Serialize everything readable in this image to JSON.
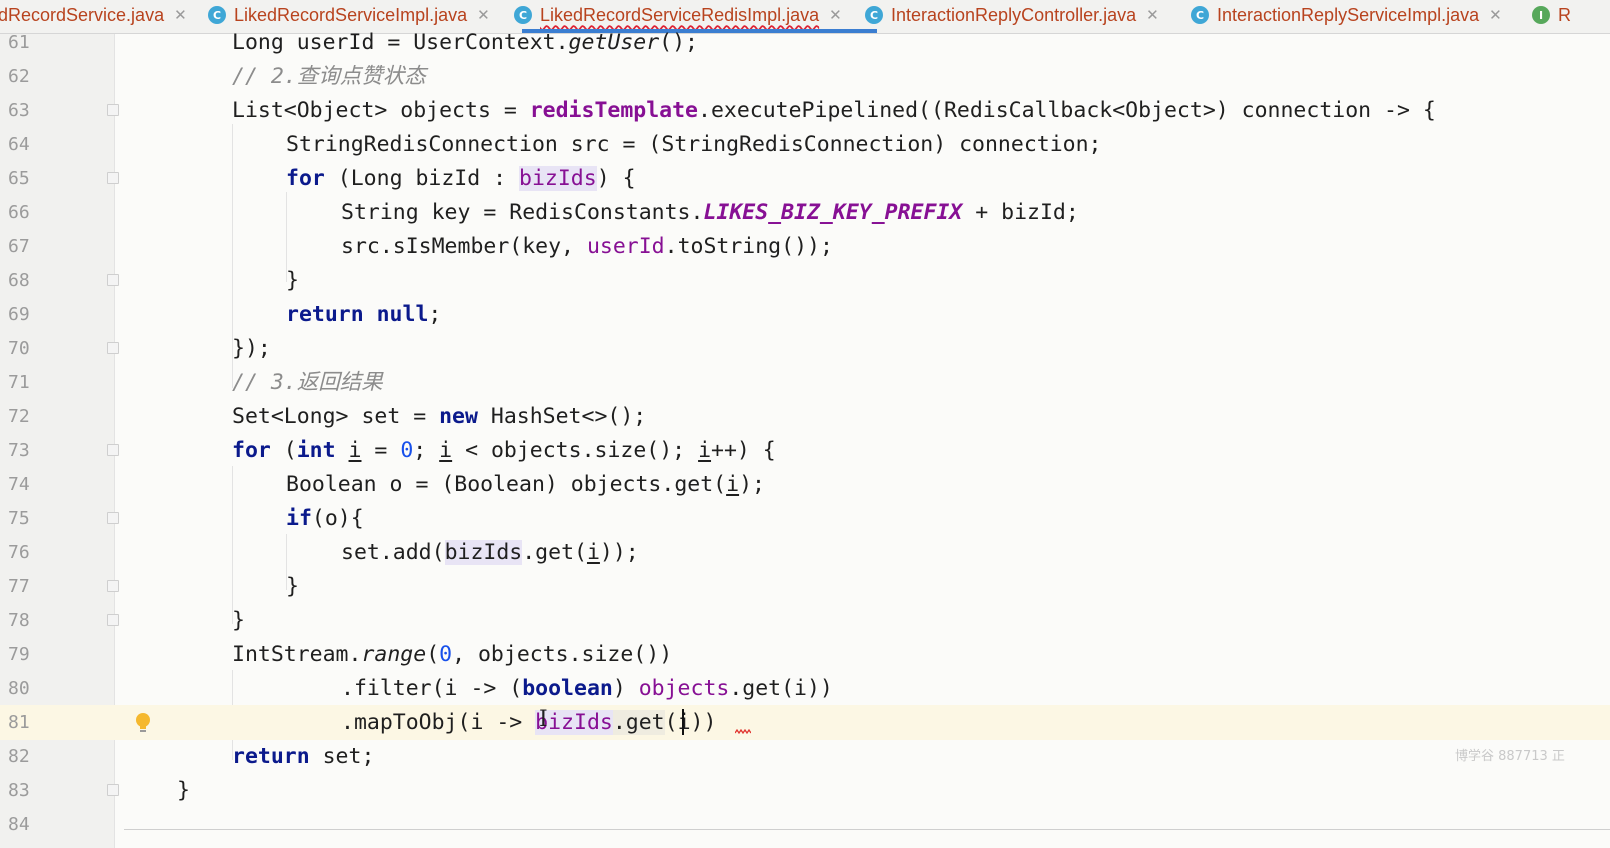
{
  "tabs": [
    {
      "label": "dRecordService.java",
      "icon": "I",
      "active": false
    },
    {
      "label": "LikedRecordServiceImpl.java",
      "icon": "C",
      "active": false
    },
    {
      "label": "LikedRecordServiceRedisImpl.java",
      "icon": "C",
      "active": true
    },
    {
      "label": "InteractionReplyController.java",
      "icon": "C",
      "active": false
    },
    {
      "label": "InteractionReplyServiceImpl.java",
      "icon": "C",
      "active": false
    },
    {
      "label": "R",
      "icon": "I",
      "active": false
    }
  ],
  "close_glyph": "✕",
  "line_numbers": [
    "61",
    "62",
    "63",
    "64",
    "65",
    "66",
    "67",
    "68",
    "69",
    "70",
    "71",
    "72",
    "73",
    "74",
    "75",
    "76",
    "77",
    "78",
    "79",
    "80",
    "81",
    "82",
    "83",
    "84"
  ],
  "code": {
    "l61": {
      "a": "Long userId = UserContext.",
      "b": "getUser",
      "c": "();"
    },
    "l62": {
      "a": "// 2.查询点赞状态"
    },
    "l63": {
      "a": "List<Object> objects = ",
      "b": "redisTemplate",
      "c": ".executePipelined((RedisCallback<Object>) connection -> {"
    },
    "l64": {
      "a": "StringRedisConnection src = (StringRedisConnection) connection;"
    },
    "l65": {
      "a": "for",
      "b": " (Long bizId : ",
      "c": "bizIds",
      "d": ") {"
    },
    "l66": {
      "a": "String key = RedisConstants.",
      "b": "LIKES_BIZ_KEY_PREFIX",
      "c": " + bizId;"
    },
    "l67": {
      "a": "src.sIsMember(key, ",
      "b": "userId",
      "c": ".toString());"
    },
    "l68": {
      "a": "}"
    },
    "l69": {
      "a": "return null",
      "b": ";"
    },
    "l70": {
      "a": "});"
    },
    "l71": {
      "a": "// 3.返回结果"
    },
    "l72": {
      "a": "Set<Long> set = ",
      "b": "new",
      "c": " HashSet<>();"
    },
    "l73": {
      "a": "for",
      "b": " (",
      "c": "int",
      "d": " ",
      "e": "i",
      "f": " = ",
      "g": "0",
      "h": "; ",
      "i": "i",
      "j": " < objects.size(); ",
      "k": "i",
      "l": "++) {"
    },
    "l74": {
      "a": "Boolean o = (Boolean) objects.get(",
      "b": "i",
      "c": ");"
    },
    "l75": {
      "a": "if",
      "b": "(o){"
    },
    "l76": {
      "a": "set.add(",
      "b": "bizIds",
      "c": ".get(",
      "d": "i",
      "e": "));"
    },
    "l77": {
      "a": "}"
    },
    "l78": {
      "a": "}"
    },
    "l79": {
      "a": "IntStream.",
      "b": "range",
      "c": "(",
      "d": "0",
      "e": ", objects.size())"
    },
    "l80": {
      "a": ".filter(i -> (",
      "b": "boolean",
      "c": ") ",
      "d": "objects",
      "e": ".get(i))"
    },
    "l81": {
      "a": ".mapToObj(i -> ",
      "b": "bizIds",
      "c": ".get",
      "d": "(i))"
    },
    "l82": {
      "a": "return",
      "b": " set;"
    },
    "l83": {
      "a": "}"
    }
  },
  "watermark": "博学谷 887713 正",
  "colors": {
    "keyword": "#0b1a8c",
    "field": "#871094",
    "comment": "#8c8c8c",
    "number": "#1750eb",
    "tab_text": "#b8431e",
    "active_tab_underline": "#3b7ed1"
  }
}
